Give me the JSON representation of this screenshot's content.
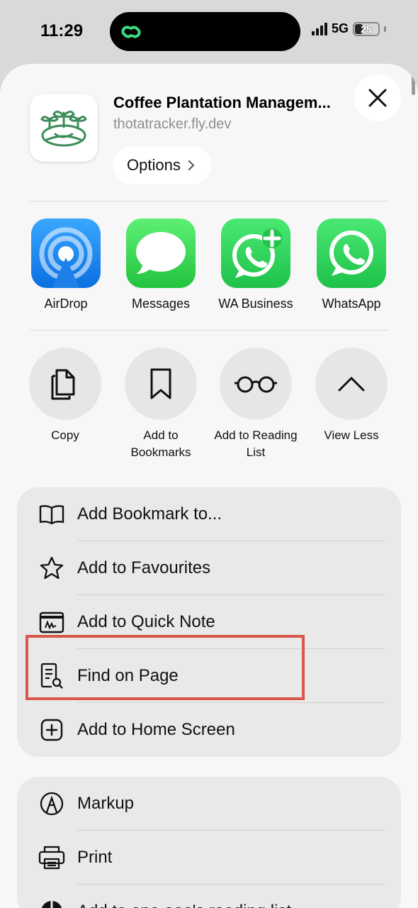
{
  "status_bar": {
    "time": "11:29",
    "network": "5G",
    "battery": "25"
  },
  "header": {
    "title": "Coffee Plantation Managem...",
    "url": "thotatracker.fly.dev",
    "options_label": "Options"
  },
  "share_targets": [
    {
      "label": "AirDrop",
      "icon": "airdrop-icon"
    },
    {
      "label": "Messages",
      "icon": "messages-icon"
    },
    {
      "label": "WA Business",
      "icon": "wa-business-icon"
    },
    {
      "label": "WhatsApp",
      "icon": "whatsapp-icon"
    }
  ],
  "actions": [
    {
      "label": "Copy",
      "icon": "copy-icon"
    },
    {
      "label": "Add to Bookmarks",
      "icon": "bookmark-icon"
    },
    {
      "label": "Add to Reading List",
      "icon": "glasses-icon"
    },
    {
      "label": "View Less",
      "icon": "chevron-up-icon"
    }
  ],
  "menu1": [
    {
      "label": "Add Bookmark to...",
      "icon": "book-icon"
    },
    {
      "label": "Add to Favourites",
      "icon": "star-icon"
    },
    {
      "label": "Add to Quick Note",
      "icon": "quick-note-icon"
    },
    {
      "label": "Find on Page",
      "icon": "find-icon"
    },
    {
      "label": "Add to Home Screen",
      "icon": "plus-square-icon"
    }
  ],
  "menu2": [
    {
      "label": "Markup",
      "icon": "markup-icon"
    },
    {
      "label": "Print",
      "icon": "printer-icon"
    },
    {
      "label": "Add to one.ooo's reading list",
      "icon": "reading-list-icon"
    }
  ],
  "colors": {
    "accent_highlight": "#d9584a",
    "whatsapp_green": "#25d366",
    "airdrop_blue": "#1e88f5"
  }
}
